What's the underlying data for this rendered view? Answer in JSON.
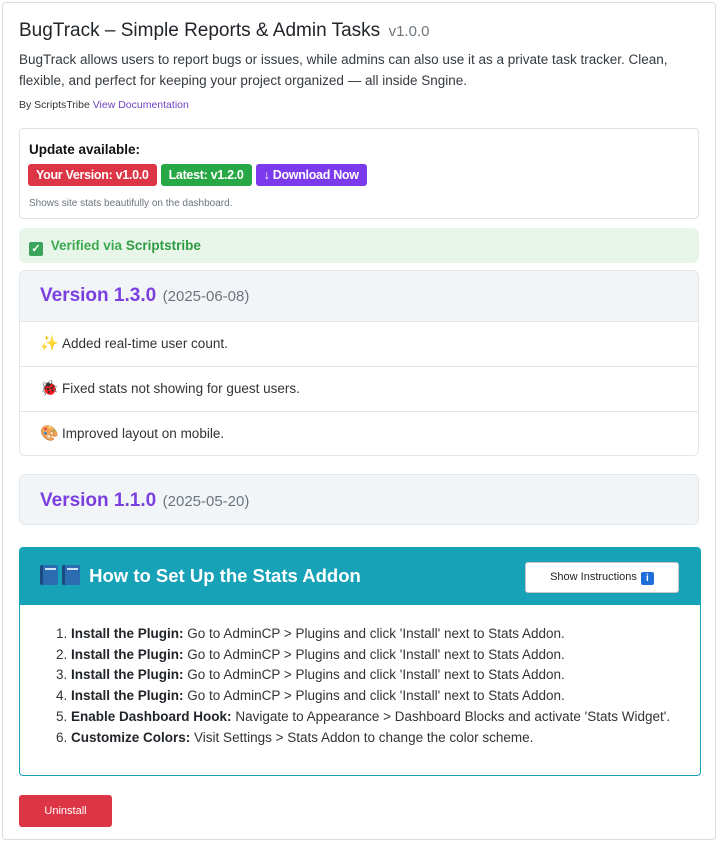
{
  "header": {
    "title": "BugTrack – Simple Reports & Admin Tasks",
    "version": "v1.0.0",
    "description": "BugTrack allows users to report bugs or issues, while admins can also use it as a private task tracker. Clean, flexible, and perfect for keeping your project organized — all inside Sngine.",
    "by_prefix": "By ScriptsTribe",
    "docs_link": "View Documentation"
  },
  "update": {
    "title": "Update available:",
    "your_version": "Your Version: v1.0.0",
    "latest": "Latest: v1.2.0",
    "download": "↓ Download Now",
    "note": "Shows site stats beautifully on the dashboard."
  },
  "verified": {
    "prefix": "Verified via",
    "brand": "Scriptstribe"
  },
  "changelog": [
    {
      "version": "Version 1.3.0",
      "date": "(2025-06-08)",
      "items": [
        {
          "icon": "sparkles-icon",
          "emoji": "✨",
          "text": "Added real-time user count."
        },
        {
          "icon": "bug-icon",
          "emoji": "🐞",
          "text": "Fixed stats not showing for guest users."
        },
        {
          "icon": "palette-icon",
          "emoji": "🎨",
          "text": "Improved layout on mobile."
        }
      ]
    },
    {
      "version": "Version 1.1.0",
      "date": "(2025-05-20)",
      "items": []
    }
  ],
  "howto": {
    "title": "How to Set Up the Stats Addon",
    "show_button": "Show Instructions",
    "info_glyph": "i",
    "steps": [
      {
        "num": "1.",
        "label": "Install the Plugin:",
        "text": " Go to AdminCP > Plugins and click 'Install' next to Stats Addon."
      },
      {
        "num": "2.",
        "label": "Install the Plugin:",
        "text": " Go to AdminCP > Plugins and click 'Install' next to Stats Addon."
      },
      {
        "num": "3.",
        "label": "Install the Plugin:",
        "text": " Go to AdminCP > Plugins and click 'Install' next to Stats Addon."
      },
      {
        "num": "4.",
        "label": "Install the Plugin:",
        "text": " Go to AdminCP > Plugins and click 'Install' next to Stats Addon."
      },
      {
        "num": "5.",
        "label": "Enable Dashboard Hook:",
        "text": " Navigate to Appearance > Dashboard Blocks and activate 'Stats Widget'."
      },
      {
        "num": "6.",
        "label": "Customize Colors:",
        "text": " Visit Settings > Stats Addon to change the color scheme."
      }
    ]
  },
  "actions": {
    "uninstall": "Uninstall"
  },
  "colors": {
    "accent_purple": "#7b3fe0",
    "danger": "#dc3545",
    "success": "#28a745",
    "info": "#17a2b8"
  }
}
